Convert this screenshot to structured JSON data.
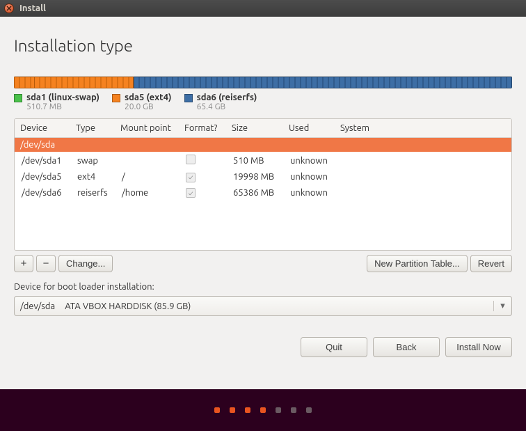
{
  "window": {
    "title": "Install"
  },
  "page": {
    "heading": "Installation type"
  },
  "usage": {
    "items": [
      {
        "name": "sda1 (linux-swap)",
        "size": "510.7 MB",
        "swatch": "sw-green"
      },
      {
        "name": "sda5 (ext4)",
        "size": "20.0 GB",
        "swatch": "sw-orange"
      },
      {
        "name": "sda6 (reiserfs)",
        "size": "65.4 GB",
        "swatch": "sw-blue"
      }
    ]
  },
  "columns": {
    "device": "Device",
    "type": "Type",
    "mount": "Mount point",
    "format": "Format?",
    "size": "Size",
    "used": "Used",
    "system": "System"
  },
  "disk": {
    "device": "/dev/sda"
  },
  "partitions": [
    {
      "device": "/dev/sda1",
      "type": "swap",
      "mount": "",
      "format": false,
      "size": "510 MB",
      "used": "unknown",
      "system": ""
    },
    {
      "device": "/dev/sda5",
      "type": "ext4",
      "mount": "/",
      "format": true,
      "size": "19998 MB",
      "used": "unknown",
      "system": ""
    },
    {
      "device": "/dev/sda6",
      "type": "reiserfs",
      "mount": "/home",
      "format": true,
      "size": "65386 MB",
      "used": "unknown",
      "system": ""
    }
  ],
  "toolbar": {
    "add": "+",
    "remove": "−",
    "change": "Change...",
    "new_table": "New Partition Table...",
    "revert": "Revert"
  },
  "bootloader": {
    "label": "Device for boot loader installation:",
    "device": "/dev/sda",
    "description": "ATA VBOX HARDDISK (85.9 GB)"
  },
  "nav": {
    "quit": "Quit",
    "back": "Back",
    "install": "Install Now"
  },
  "pager": {
    "total": 7,
    "active_index": 3
  }
}
